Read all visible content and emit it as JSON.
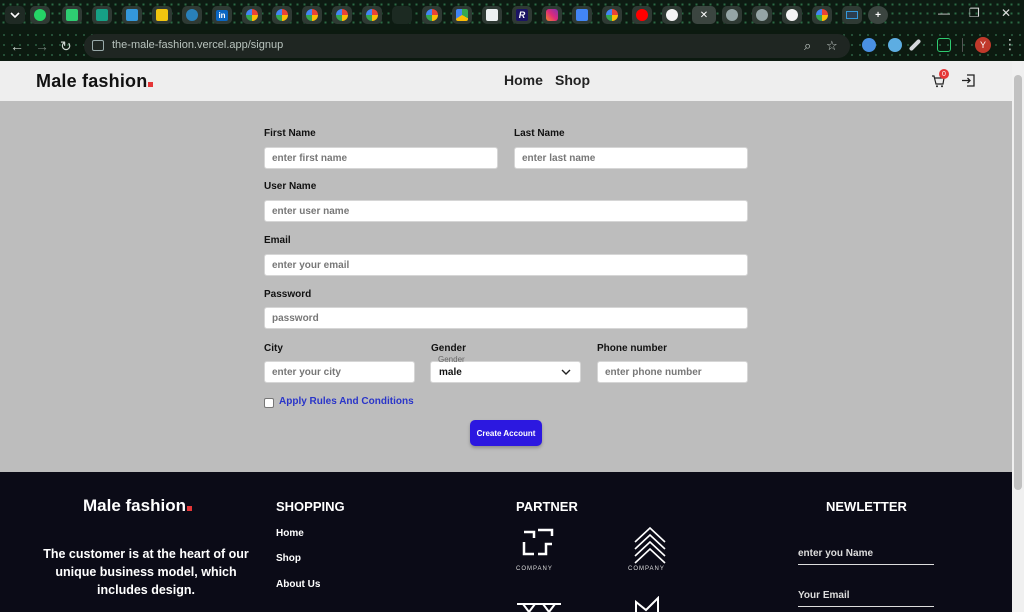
{
  "browser": {
    "url": "the-male-fashion.vercel.app/signup",
    "profile_initial": "Y",
    "tab_icons": [
      "chevron-down-icon",
      "whatsapp-icon",
      "tab-icon",
      "tab-icon",
      "tab-icon",
      "tab-icon",
      "tab-icon",
      "linkedin-icon",
      "google-icon",
      "google-icon",
      "google-icon",
      "google-icon",
      "google-icon",
      "tab-icon",
      "google-icon",
      "drive-icon",
      "tab-icon",
      "r-icon",
      "instagram-icon",
      "translate-icon",
      "google-icon",
      "youtube-icon",
      "github-icon",
      "close-icon",
      "globe-icon",
      "globe-icon",
      "github-icon",
      "google-icon",
      "tab-icon",
      "plus-icon"
    ],
    "tab_letters": {
      "linkedin": "in",
      "r": "R"
    }
  },
  "header": {
    "logo": "Male fashion",
    "nav": [
      "Home",
      "Shop"
    ],
    "cart_count": "0"
  },
  "form": {
    "first_name_label": "First Name",
    "first_name_placeholder": "enter first name",
    "last_name_label": "Last Name",
    "last_name_placeholder": "enter last name",
    "username_label": "User Name",
    "username_placeholder": "enter user name",
    "email_label": "Email",
    "email_placeholder": "enter your email",
    "password_label": "Password",
    "password_placeholder": "password",
    "city_label": "City",
    "city_placeholder": "enter your city",
    "gender_label": "Gender",
    "gender_float_label": "Gender",
    "gender_value": "male",
    "phone_label": "Phone number",
    "phone_placeholder": "enter phone number",
    "rules_label": "Apply Rules And Conditions",
    "submit_label": "Create Account"
  },
  "footer": {
    "logo": "Male fashion",
    "description": "The customer is at the heart of our unique business model, which includes design.",
    "shopping_heading": "SHOPPING",
    "shopping_links": [
      "Home",
      "Shop",
      "About Us"
    ],
    "partner_heading": "PARTNER",
    "partner_caption": "COMPANY",
    "newsletter_heading": "NEWLETTER",
    "newsletter_name_placeholder": "enter you Name",
    "newsletter_email_placeholder": "Your Email"
  },
  "colors": {
    "accent": "#e53637",
    "button": "#2c18e0",
    "link": "#2a35c9",
    "page_bg": "#bdbdbd",
    "footer_bg": "#0b0b17"
  }
}
